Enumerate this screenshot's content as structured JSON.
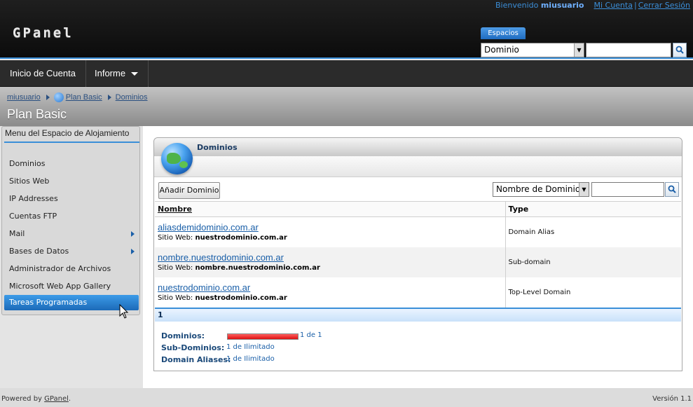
{
  "header": {
    "logo": "GPanel",
    "welcome_prefix": "Bienvenido",
    "username": "miusuario",
    "my_account": "Mi Cuenta",
    "logout": "Cerrar Sesión",
    "spaces_tab": "Espacios",
    "search_scope": "Dominio",
    "search_value": ""
  },
  "nav": {
    "items": [
      {
        "label": "Inicio de Cuenta"
      },
      {
        "label": "Informe"
      }
    ]
  },
  "breadcrumb": {
    "items": [
      "miusuario",
      "Plan Basic",
      "Dominios"
    ]
  },
  "page_title": "Plan Basic",
  "sidebar": {
    "title": "Menu del Espacio de Alojamiento",
    "items": [
      {
        "label": "Dominios",
        "submenu": false
      },
      {
        "label": "Sitios Web",
        "submenu": false
      },
      {
        "label": "IP Addresses",
        "submenu": false
      },
      {
        "label": "Cuentas FTP",
        "submenu": false
      },
      {
        "label": "Mail",
        "submenu": true
      },
      {
        "label": "Bases de Datos",
        "submenu": true
      },
      {
        "label": "Administrador de Archivos",
        "submenu": false
      },
      {
        "label": "Microsoft Web App Gallery",
        "submenu": false
      },
      {
        "label": "Tareas Programadas",
        "submenu": false,
        "active": true
      }
    ]
  },
  "main": {
    "title": "Dominios",
    "add_button": "Añadir Dominio",
    "filter_field": "Nombre de Dominio",
    "filter_value": "",
    "columns": [
      "Nombre",
      "Type"
    ],
    "rows": [
      {
        "domain": "aliasdemidominio.com.ar",
        "site_label": "Sitio Web:",
        "site": "nuestrodominio.com.ar",
        "type": "Domain Alias"
      },
      {
        "domain": "nombre.nuestrodominio.com.ar",
        "site_label": "Sitio Web:",
        "site": "nombre.nuestrodominio.com.ar",
        "type": "Sub-domain"
      },
      {
        "domain": "nuestrodominio.com.ar",
        "site_label": "Sitio Web:",
        "site": "nuestrodominio.com.ar",
        "type": "Top-Level Domain"
      }
    ],
    "pager": "1",
    "quotas": [
      {
        "label": "Dominios:",
        "value": "1 de 1",
        "fraction": 1.0,
        "bar": true
      },
      {
        "label": "Sub-Dominios:",
        "value": "1 de Ilimitado",
        "bar": false
      },
      {
        "label": "Domain Aliases:",
        "value": "1 de Ilimitado",
        "bar": false
      }
    ]
  },
  "footer": {
    "powered_prefix": "Powered by",
    "powered_link": "GPanel",
    "powered_suffix": ".",
    "version": "Versión 1.1"
  },
  "colors": {
    "accent": "#3a8fd8",
    "link": "#1a5fa8",
    "quota_fill": "#dd1010"
  }
}
